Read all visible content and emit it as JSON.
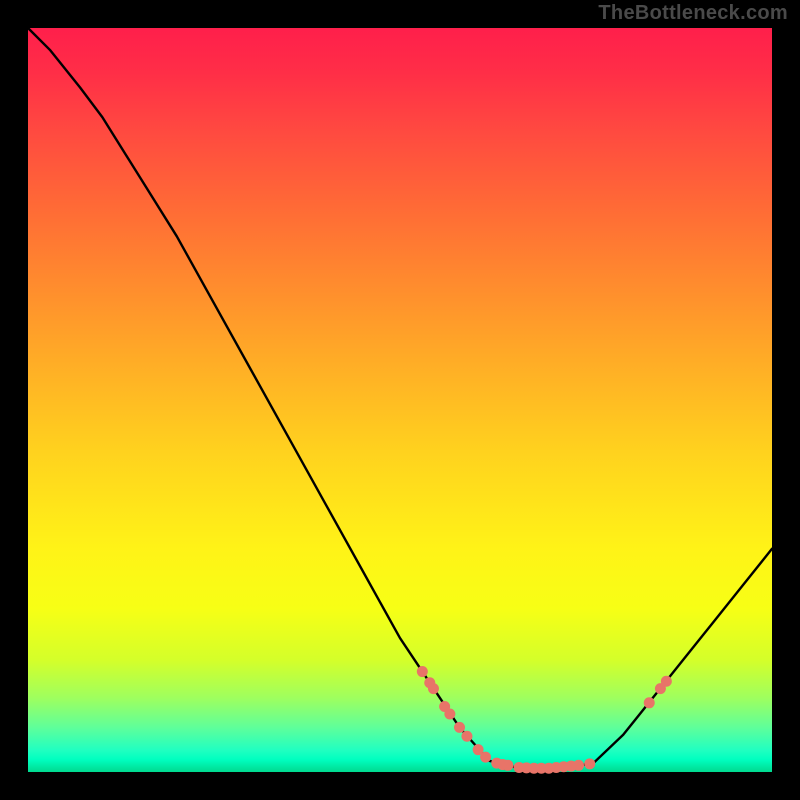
{
  "watermark": "TheBottleneck.com",
  "colors": {
    "background": "#000000",
    "curve_stroke": "#000000",
    "marker_fill": "#e87468",
    "watermark_text": "#4a4a4a"
  },
  "chart_data": {
    "type": "line",
    "title": "",
    "xlabel": "",
    "ylabel": "",
    "xlim": [
      0,
      100
    ],
    "ylim": [
      0,
      100
    ],
    "grid": false,
    "axes_visible": false,
    "curve": [
      {
        "x": 0,
        "y": 100
      },
      {
        "x": 3,
        "y": 97
      },
      {
        "x": 7,
        "y": 92
      },
      {
        "x": 10,
        "y": 88
      },
      {
        "x": 15,
        "y": 80
      },
      {
        "x": 20,
        "y": 72
      },
      {
        "x": 25,
        "y": 63
      },
      {
        "x": 30,
        "y": 54
      },
      {
        "x": 35,
        "y": 45
      },
      {
        "x": 40,
        "y": 36
      },
      {
        "x": 45,
        "y": 27
      },
      {
        "x": 50,
        "y": 18
      },
      {
        "x": 54,
        "y": 12
      },
      {
        "x": 58,
        "y": 6
      },
      {
        "x": 62,
        "y": 1.5
      },
      {
        "x": 66,
        "y": 0.5
      },
      {
        "x": 72,
        "y": 0.5
      },
      {
        "x": 76,
        "y": 1.2
      },
      {
        "x": 80,
        "y": 5
      },
      {
        "x": 84,
        "y": 10
      },
      {
        "x": 88,
        "y": 15
      },
      {
        "x": 92,
        "y": 20
      },
      {
        "x": 96,
        "y": 25
      },
      {
        "x": 100,
        "y": 30
      }
    ],
    "markers": [
      {
        "x": 53,
        "y": 13.5
      },
      {
        "x": 54,
        "y": 12.0
      },
      {
        "x": 54.5,
        "y": 11.2
      },
      {
        "x": 56,
        "y": 8.8
      },
      {
        "x": 56.7,
        "y": 7.8
      },
      {
        "x": 58,
        "y": 6.0
      },
      {
        "x": 59,
        "y": 4.8
      },
      {
        "x": 60.5,
        "y": 3.0
      },
      {
        "x": 61.5,
        "y": 2.0
      },
      {
        "x": 63,
        "y": 1.2
      },
      {
        "x": 63.8,
        "y": 1.0
      },
      {
        "x": 64.5,
        "y": 0.9
      },
      {
        "x": 66,
        "y": 0.6
      },
      {
        "x": 67,
        "y": 0.55
      },
      {
        "x": 68,
        "y": 0.5
      },
      {
        "x": 69,
        "y": 0.5
      },
      {
        "x": 70,
        "y": 0.5
      },
      {
        "x": 71,
        "y": 0.6
      },
      {
        "x": 72,
        "y": 0.7
      },
      {
        "x": 73,
        "y": 0.8
      },
      {
        "x": 74,
        "y": 0.9
      },
      {
        "x": 75.5,
        "y": 1.1
      },
      {
        "x": 83.5,
        "y": 9.3
      },
      {
        "x": 85,
        "y": 11.2
      },
      {
        "x": 85.8,
        "y": 12.2
      }
    ]
  }
}
